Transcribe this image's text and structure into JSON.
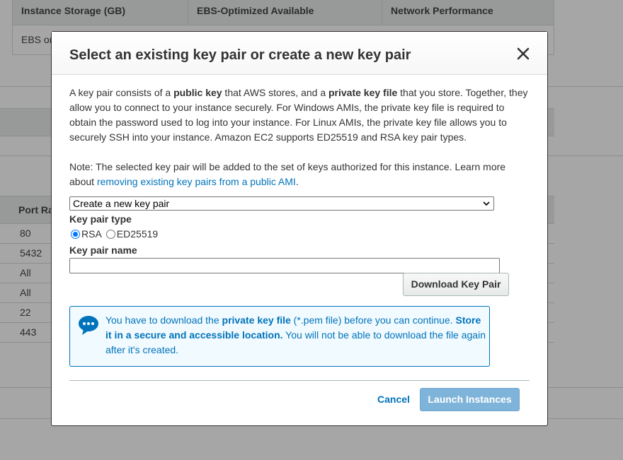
{
  "background": {
    "top_table": {
      "headers": [
        "Instance Storage (GB)",
        "EBS-Optimized Available",
        "Network Performance"
      ],
      "cell": "EBS only"
    },
    "port_table": {
      "header": "Port Range",
      "rows": [
        "80",
        "5432",
        "All",
        "All",
        "22",
        "443"
      ]
    }
  },
  "modal": {
    "title": "Select an existing key pair or create a new key pair",
    "close_icon": "close-icon",
    "intro": {
      "t1": "A key pair consists of a ",
      "b1": "public key",
      "t2": " that AWS stores, and a ",
      "b2": "private key file",
      "t3": " that you store. Together, they allow you to connect to your instance securely. For Windows AMIs, the private key file is required to obtain the password used to log into your instance. For Linux AMIs, the private key file allows you to securely SSH into your instance. Amazon EC2 supports ED25519 and RSA key pair types."
    },
    "note": {
      "text": "Note: The selected key pair will be added to the set of keys authorized for this instance. Learn more about ",
      "link": "removing existing key pairs from a public AMI",
      "end": "."
    },
    "key_pair_select": {
      "value": "Create a new key pair"
    },
    "key_pair_type": {
      "label": "Key pair type",
      "options": [
        "RSA",
        "ED25519"
      ],
      "selected": "RSA"
    },
    "key_pair_name": {
      "label": "Key pair name",
      "value": ""
    },
    "download_button": "Download Key Pair",
    "info": {
      "icon": "chat-bubble-icon",
      "t1": "You have to download the ",
      "b1": "private key file",
      "t2": " (*.pem file) before you can continue. ",
      "b2": "Store it in a secure and accessible location.",
      "t3": " You will not be able to download the file again after it's created."
    },
    "cancel": "Cancel",
    "launch": "Launch Instances"
  },
  "colors": {
    "link": "#0073bb",
    "info_background": "#f1faff",
    "launch_disabled": "#7fb4da",
    "radio_selected": "#0075ff"
  }
}
